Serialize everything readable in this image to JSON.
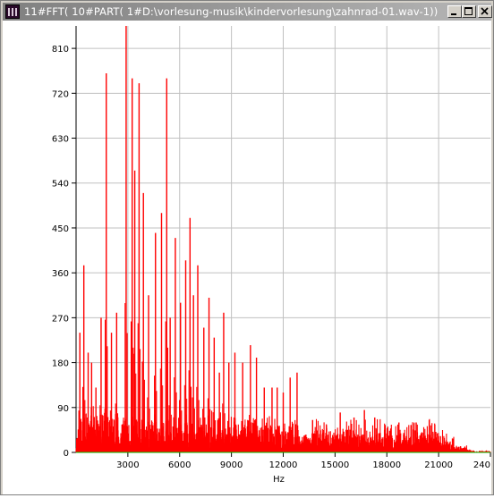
{
  "window": {
    "title": "11#FFT( 10#PART( 1#D:\\vorlesung-musik\\kindervorlesung\\zahnrad-01.wav-1))",
    "icon": "wave-app-icon",
    "controls": [
      "minimize-icon",
      "maximize-icon",
      "close-icon"
    ]
  },
  "colors": {
    "spectrum": "#ff0000",
    "baseline": "#00c000",
    "grid": "#c0c0c0",
    "titlebar": "#808080"
  },
  "chart_data": {
    "type": "area",
    "xlabel": "Hz",
    "ylabel": "",
    "xlim": [
      0,
      24000
    ],
    "ylim": [
      0,
      855
    ],
    "grid": true,
    "x_ticks": [
      "3000",
      "6000",
      "9000",
      "12000",
      "15000",
      "18000",
      "21000",
      "240"
    ],
    "y_ticks": [
      "0",
      "90",
      "180",
      "270",
      "360",
      "450",
      "540",
      "630",
      "720",
      "810"
    ],
    "series": [
      {
        "peaks_hz": [
          220,
          450,
          700,
          900,
          1150,
          1450,
          1750,
          2050,
          2350,
          2900,
          3250,
          3400,
          3650,
          3900,
          4200,
          4600,
          4950,
          5250,
          5450,
          5750,
          6050,
          6350,
          6600,
          6800,
          7050,
          7400,
          7700,
          8000,
          8300,
          8550,
          8850,
          9200,
          9650,
          10100,
          10450,
          10900,
          11350,
          11650,
          12000,
          12400,
          12800,
          13700,
          14500,
          15300,
          16100,
          16700,
          17300,
          17900,
          18700,
          19400,
          19700
        ],
        "peak_values": [
          240,
          375,
          200,
          180,
          130,
          270,
          760,
          240,
          280,
          855,
          750,
          565,
          740,
          520,
          315,
          440,
          480,
          750,
          270,
          430,
          300,
          385,
          470,
          315,
          375,
          250,
          310,
          230,
          160,
          280,
          180,
          200,
          180,
          215,
          190,
          130,
          130,
          130,
          120,
          150,
          160,
          65,
          55,
          80,
          70,
          85,
          70,
          55,
          60,
          55,
          60
        ]
      }
    ]
  }
}
